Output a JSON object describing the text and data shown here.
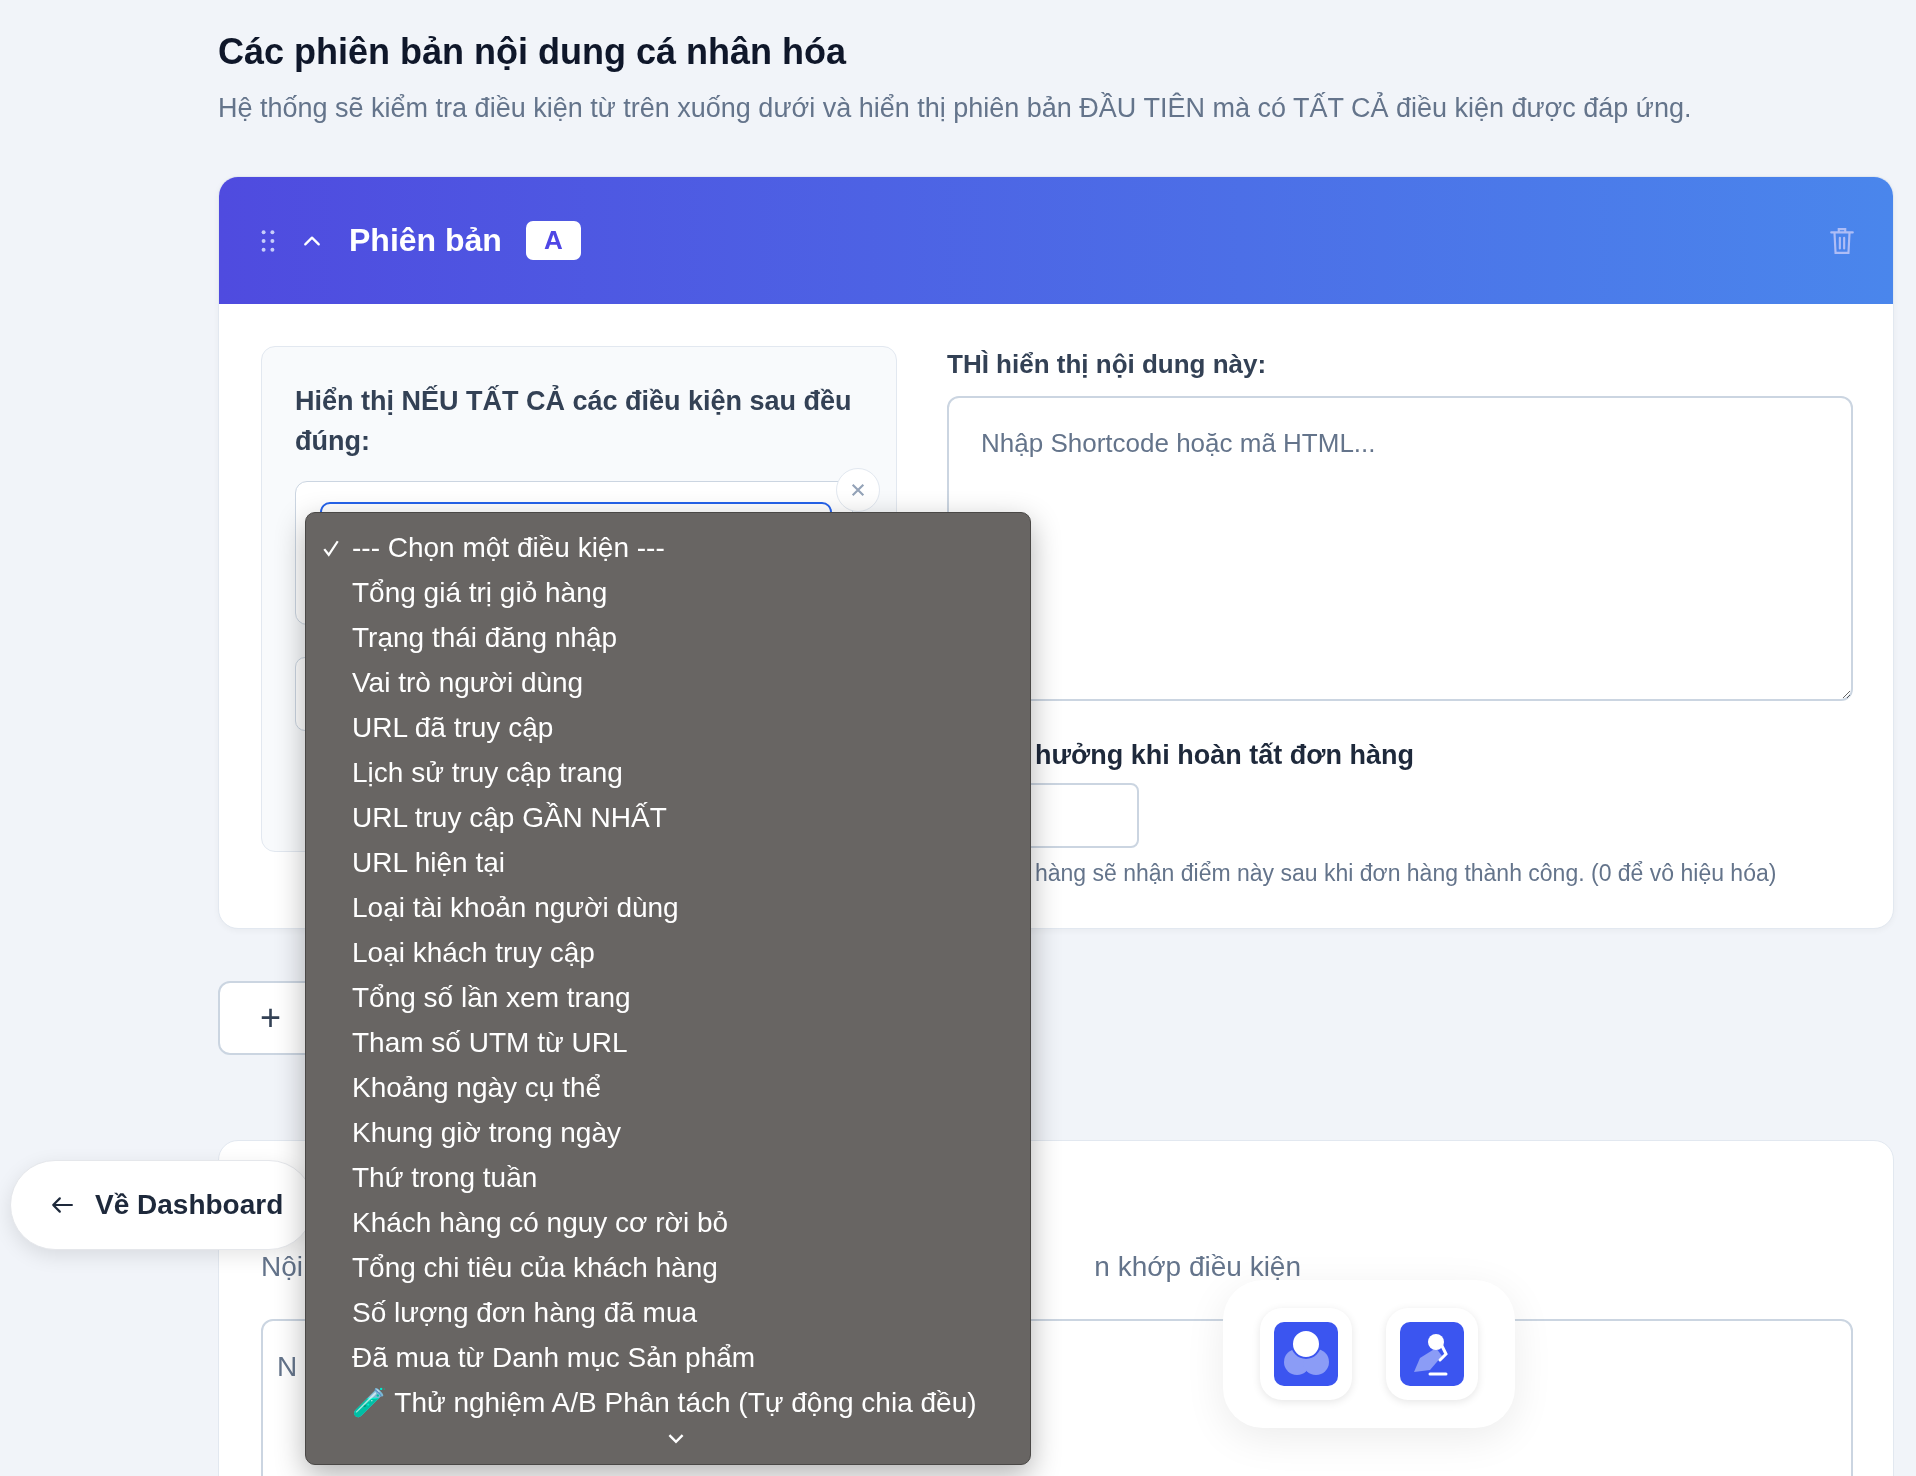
{
  "page": {
    "title": "Các phiên bản nội dung cá nhân hóa",
    "subtitle": "Hệ thống sẽ kiểm tra điều kiện từ trên xuống dưới và hiển thị phiên bản ĐẦU TIÊN mà có TẤT CẢ điều kiện được đáp ứng."
  },
  "version_card": {
    "label": "Phiên bản",
    "badge": "A",
    "expanded": true,
    "conditions": {
      "heading": "Hiển thị NẾU TẤT CẢ các điều kiện sau đều đúng:"
    },
    "content": {
      "label": "THÌ hiển thị nội dung này:",
      "placeholder": "Nhập Shortcode hoặc mã HTML..."
    },
    "reward": {
      "label": "hưởng khi hoàn tất đơn hàng",
      "help": "hàng sẽ nhận điểm này sau khi đơn hàng thành công. (0 để vô hiệu hóa)"
    }
  },
  "add_button": {
    "label": "+"
  },
  "default_card": {
    "label_start": "Nội",
    "label_end": "n khớp điều kiện",
    "placeholder": "N"
  },
  "back_button": {
    "label": "Về Dashboard"
  },
  "dropdown": {
    "options": [
      {
        "label": "--- Chọn một điều kiện ---",
        "selected": true
      },
      {
        "label": "Tổng giá trị giỏ hàng",
        "selected": false
      },
      {
        "label": "Trạng thái đăng nhập",
        "selected": false
      },
      {
        "label": "Vai trò người dùng",
        "selected": false
      },
      {
        "label": "URL đã truy cập",
        "selected": false
      },
      {
        "label": "Lịch sử truy cập trang",
        "selected": false
      },
      {
        "label": "URL truy cập GẦN NHẤT",
        "selected": false
      },
      {
        "label": "URL hiện tại",
        "selected": false
      },
      {
        "label": "Loại tài khoản người dùng",
        "selected": false
      },
      {
        "label": "Loại khách truy cập",
        "selected": false
      },
      {
        "label": "Tổng số lần xem trang",
        "selected": false
      },
      {
        "label": "Tham số UTM từ URL",
        "selected": false
      },
      {
        "label": "Khoảng ngày cụ thể",
        "selected": false
      },
      {
        "label": "Khung giờ trong ngày",
        "selected": false
      },
      {
        "label": "Thứ trong tuần",
        "selected": false
      },
      {
        "label": "Khách hàng có nguy cơ rời bỏ",
        "selected": false
      },
      {
        "label": "Tổng chi tiêu của khách hàng",
        "selected": false
      },
      {
        "label": "Số lượng đơn hàng đã mua",
        "selected": false
      },
      {
        "label": "Đã mua từ Danh mục Sản phẩm",
        "selected": false
      },
      {
        "label": "🧪 Thử nghiệm A/B Phân tách (Tự động chia đều)",
        "selected": false
      }
    ]
  }
}
